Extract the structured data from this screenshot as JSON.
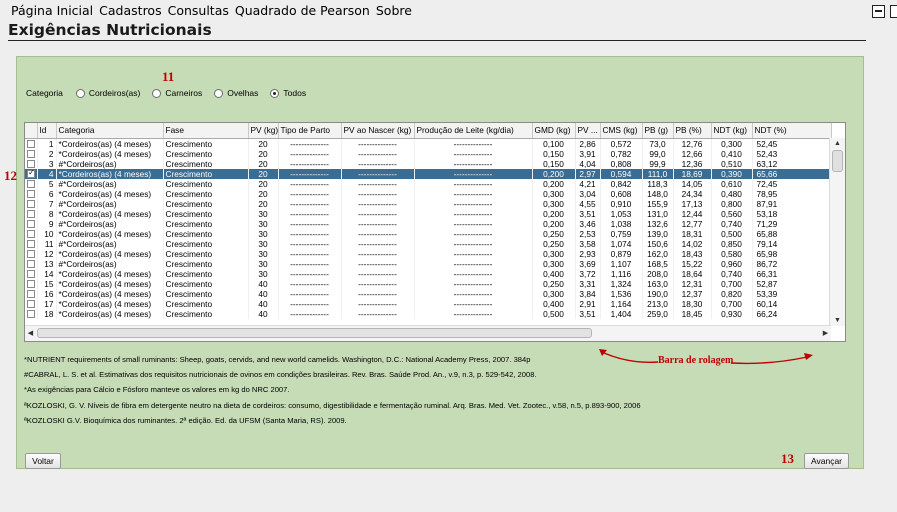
{
  "menu": [
    "Página Inicial",
    "Cadastros",
    "Consultas",
    "Quadrado de Pearson",
    "Sobre"
  ],
  "page_title": "Exigências Nutricionais",
  "category": {
    "label": "Categoria",
    "options": [
      {
        "label": "Cordeiros(as)",
        "checked": false
      },
      {
        "label": "Carneiros",
        "checked": false
      },
      {
        "label": "Ovelhas",
        "checked": false
      },
      {
        "label": "Todos",
        "checked": true
      }
    ]
  },
  "table": {
    "columns": [
      "",
      "Id",
      "Categoria",
      "Fase",
      "PV (kg)",
      "Tipo de Parto",
      "PV ao Nascer (kg)",
      "Produção de Leite (kg/dia)",
      "GMD (kg)",
      "PV ...",
      "CMS (kg)",
      "PB (g)",
      "PB (%)",
      "NDT (kg)",
      "NDT (%)"
    ],
    "rows": [
      {
        "id": "1",
        "categoria": "*Cordeiros(as) (4 meses)",
        "fase": "Crescimento",
        "pv": "20",
        "parto": "--------------",
        "nascer": "--------------",
        "leite": "--------------",
        "gmd": "0,100",
        "pv2": "2,86",
        "cms": "0,572",
        "pbg": "73,0",
        "pbp": "12,76",
        "ndt": "0,300",
        "ndtp": "52,45",
        "checked": false,
        "selected": false
      },
      {
        "id": "2",
        "categoria": "*Cordeiros(as) (4 meses)",
        "fase": "Crescimento",
        "pv": "20",
        "parto": "--------------",
        "nascer": "--------------",
        "leite": "--------------",
        "gmd": "0,150",
        "pv2": "3,91",
        "cms": "0,782",
        "pbg": "99,0",
        "pbp": "12,66",
        "ndt": "0,410",
        "ndtp": "52,43",
        "checked": false,
        "selected": false
      },
      {
        "id": "3",
        "categoria": "#*Cordeiros(as)",
        "fase": "Crescimento",
        "pv": "20",
        "parto": "--------------",
        "nascer": "--------------",
        "leite": "--------------",
        "gmd": "0,150",
        "pv2": "4,04",
        "cms": "0,808",
        "pbg": "99,9",
        "pbp": "12,36",
        "ndt": "0,510",
        "ndtp": "63,12",
        "checked": false,
        "selected": false
      },
      {
        "id": "4",
        "categoria": "*Cordeiros(as) (4 meses)",
        "fase": "Crescimento",
        "pv": "20",
        "parto": "--------------",
        "nascer": "--------------",
        "leite": "--------------",
        "gmd": "0,200",
        "pv2": "2,97",
        "cms": "0,594",
        "pbg": "111,0",
        "pbp": "18,69",
        "ndt": "0,390",
        "ndtp": "65,66",
        "checked": true,
        "selected": true
      },
      {
        "id": "5",
        "categoria": "#*Cordeiros(as)",
        "fase": "Crescimento",
        "pv": "20",
        "parto": "--------------",
        "nascer": "--------------",
        "leite": "--------------",
        "gmd": "0,200",
        "pv2": "4,21",
        "cms": "0,842",
        "pbg": "118,3",
        "pbp": "14,05",
        "ndt": "0,610",
        "ndtp": "72,45",
        "checked": false,
        "selected": false
      },
      {
        "id": "6",
        "categoria": "*Cordeiros(as) (4 meses)",
        "fase": "Crescimento",
        "pv": "20",
        "parto": "--------------",
        "nascer": "--------------",
        "leite": "--------------",
        "gmd": "0,300",
        "pv2": "3,04",
        "cms": "0,608",
        "pbg": "148,0",
        "pbp": "24,34",
        "ndt": "0,480",
        "ndtp": "78,95",
        "checked": false,
        "selected": false
      },
      {
        "id": "7",
        "categoria": "#*Cordeiros(as)",
        "fase": "Crescimento",
        "pv": "20",
        "parto": "--------------",
        "nascer": "--------------",
        "leite": "--------------",
        "gmd": "0,300",
        "pv2": "4,55",
        "cms": "0,910",
        "pbg": "155,9",
        "pbp": "17,13",
        "ndt": "0,800",
        "ndtp": "87,91",
        "checked": false,
        "selected": false
      },
      {
        "id": "8",
        "categoria": "*Cordeiros(as) (4 meses)",
        "fase": "Crescimento",
        "pv": "30",
        "parto": "--------------",
        "nascer": "--------------",
        "leite": "--------------",
        "gmd": "0,200",
        "pv2": "3,51",
        "cms": "1,053",
        "pbg": "131,0",
        "pbp": "12,44",
        "ndt": "0,560",
        "ndtp": "53,18",
        "checked": false,
        "selected": false
      },
      {
        "id": "9",
        "categoria": "#*Cordeiros(as)",
        "fase": "Crescimento",
        "pv": "30",
        "parto": "--------------",
        "nascer": "--------------",
        "leite": "--------------",
        "gmd": "0,200",
        "pv2": "3,46",
        "cms": "1,038",
        "pbg": "132,6",
        "pbp": "12,77",
        "ndt": "0,740",
        "ndtp": "71,29",
        "checked": false,
        "selected": false
      },
      {
        "id": "10",
        "categoria": "*Cordeiros(as) (4 meses)",
        "fase": "Crescimento",
        "pv": "30",
        "parto": "--------------",
        "nascer": "--------------",
        "leite": "--------------",
        "gmd": "0,250",
        "pv2": "2,53",
        "cms": "0,759",
        "pbg": "139,0",
        "pbp": "18,31",
        "ndt": "0,500",
        "ndtp": "65,88",
        "checked": false,
        "selected": false
      },
      {
        "id": "11",
        "categoria": "#*Cordeiros(as)",
        "fase": "Crescimento",
        "pv": "30",
        "parto": "--------------",
        "nascer": "--------------",
        "leite": "--------------",
        "gmd": "0,250",
        "pv2": "3,58",
        "cms": "1,074",
        "pbg": "150,6",
        "pbp": "14,02",
        "ndt": "0,850",
        "ndtp": "79,14",
        "checked": false,
        "selected": false
      },
      {
        "id": "12",
        "categoria": "*Cordeiros(as) (4 meses)",
        "fase": "Crescimento",
        "pv": "30",
        "parto": "--------------",
        "nascer": "--------------",
        "leite": "--------------",
        "gmd": "0,300",
        "pv2": "2,93",
        "cms": "0,879",
        "pbg": "162,0",
        "pbp": "18,43",
        "ndt": "0,580",
        "ndtp": "65,98",
        "checked": false,
        "selected": false
      },
      {
        "id": "13",
        "categoria": "#*Cordeiros(as)",
        "fase": "Crescimento",
        "pv": "30",
        "parto": "--------------",
        "nascer": "--------------",
        "leite": "--------------",
        "gmd": "0,300",
        "pv2": "3,69",
        "cms": "1,107",
        "pbg": "168,5",
        "pbp": "15,22",
        "ndt": "0,960",
        "ndtp": "86,72",
        "checked": false,
        "selected": false
      },
      {
        "id": "14",
        "categoria": "*Cordeiros(as) (4 meses)",
        "fase": "Crescimento",
        "pv": "30",
        "parto": "--------------",
        "nascer": "--------------",
        "leite": "--------------",
        "gmd": "0,400",
        "pv2": "3,72",
        "cms": "1,116",
        "pbg": "208,0",
        "pbp": "18,64",
        "ndt": "0,740",
        "ndtp": "66,31",
        "checked": false,
        "selected": false
      },
      {
        "id": "15",
        "categoria": "*Cordeiros(as) (4 meses)",
        "fase": "Crescimento",
        "pv": "40",
        "parto": "--------------",
        "nascer": "--------------",
        "leite": "--------------",
        "gmd": "0,250",
        "pv2": "3,31",
        "cms": "1,324",
        "pbg": "163,0",
        "pbp": "12,31",
        "ndt": "0,700",
        "ndtp": "52,87",
        "checked": false,
        "selected": false
      },
      {
        "id": "16",
        "categoria": "*Cordeiros(as) (4 meses)",
        "fase": "Crescimento",
        "pv": "40",
        "parto": "--------------",
        "nascer": "--------------",
        "leite": "--------------",
        "gmd": "0,300",
        "pv2": "3,84",
        "cms": "1,536",
        "pbg": "190,0",
        "pbp": "12,37",
        "ndt": "0,820",
        "ndtp": "53,39",
        "checked": false,
        "selected": false
      },
      {
        "id": "17",
        "categoria": "*Cordeiros(as) (4 meses)",
        "fase": "Crescimento",
        "pv": "40",
        "parto": "--------------",
        "nascer": "--------------",
        "leite": "--------------",
        "gmd": "0,400",
        "pv2": "2,91",
        "cms": "1,164",
        "pbg": "213,0",
        "pbp": "18,30",
        "ndt": "0,700",
        "ndtp": "60,14",
        "checked": false,
        "selected": false
      },
      {
        "id": "18",
        "categoria": "*Cordeiros(as) (4 meses)",
        "fase": "Crescimento",
        "pv": "40",
        "parto": "--------------",
        "nascer": "--------------",
        "leite": "--------------",
        "gmd": "0,500",
        "pv2": "3,51",
        "cms": "1,404",
        "pbg": "259,0",
        "pbp": "18,45",
        "ndt": "0,930",
        "ndtp": "66,24",
        "checked": false,
        "selected": false
      }
    ]
  },
  "footnotes": [
    "*NUTRIENT requirements of small ruminants: Sheep, goats, cervids, and new world camelids. Washington, D.C.: National Academy Press, 2007. 384p",
    "#CABRAL, L. S. et al. Estimativas dos requisitos nutricionais de ovinos em condições brasileiras. Rev. Bras. Saúde Prod. An., v.9, n.3, p. 529-542, 2008.",
    "*As exigências para Cálcio e Fósforo manteve os valores em kg do NRC 2007.",
    "ªKOZLOSKI, G. V. Níveis de fibra em detergente neutro na dieta de cordeiros: consumo, digestibilidade e fermentação ruminal. Arq. Bras. Med. Vet. Zootec., v.58, n.5, p.893-900, 2006",
    "ªKOZLOSKI G.V. Bioquímica dos ruminantes. 2ª edição. Ed. da UFSM (Santa Maria, RS). 2009."
  ],
  "buttons": {
    "back": "Voltar",
    "next": "Avançar"
  },
  "annotations": {
    "n11": "11",
    "n12": "12",
    "n13": "13",
    "scrollbar_label": "Barra de rolagem"
  },
  "colors": {
    "panel_bg": "#c6dcb6",
    "selected_row": "#3b6d93",
    "annotation": "#c00000"
  }
}
